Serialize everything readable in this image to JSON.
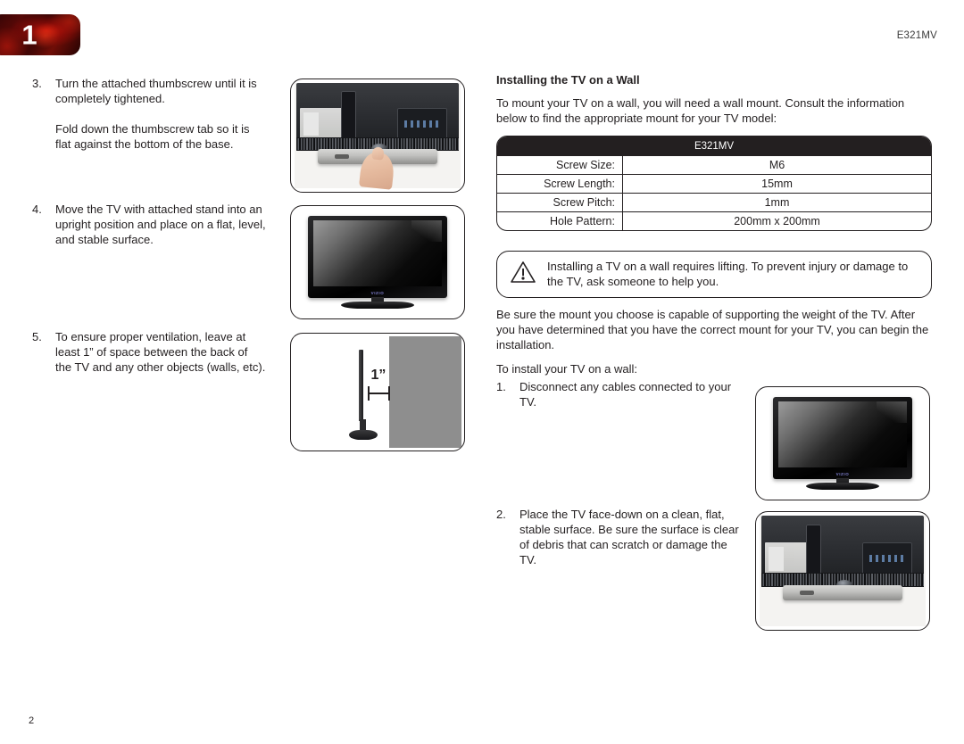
{
  "header": {
    "chapter_number": "1",
    "model": "E321MV"
  },
  "left_column": {
    "steps": [
      {
        "num": "3.",
        "paragraphs": [
          "Turn the attached thumbscrew until it is completely tightened.",
          "Fold down the thumbscrew tab so it is flat against the bottom of the base."
        ]
      },
      {
        "num": "4.",
        "paragraphs": [
          "Move the TV with attached stand into an upright position and place on a flat, level, and stable surface."
        ]
      },
      {
        "num": "5.",
        "paragraphs": [
          "To ensure proper ventilation, leave at least 1” of space between the back of the TV and any other objects (walls, etc)."
        ]
      }
    ]
  },
  "figures": {
    "thumbscrew_caption": "",
    "clearance_label": "1”",
    "tv_logo": "VIZIO"
  },
  "right_column": {
    "heading": "Installing the TV on a Wall",
    "intro": "To mount your TV on a wall, you will need a wall mount. Consult the information below to find the appropriate mount for your TV model:",
    "table": {
      "header": "E321MV",
      "rows": [
        {
          "label": "Screw Size:",
          "value": "M6"
        },
        {
          "label": "Screw Length:",
          "value": "15mm"
        },
        {
          "label": "Screw Pitch:",
          "value": "1mm"
        },
        {
          "label": "Hole Pattern:",
          "value": "200mm x 200mm"
        }
      ]
    },
    "warning": "Installing a TV on a wall requires lifting. To prevent injury or damage to the TV, ask someone to help you.",
    "body_paragraph": "Be sure the mount you choose is capable of supporting the weight of the TV. After you have determined that you have the correct mount for your TV, you can begin the installation.",
    "lead_in": "To install your TV on a wall:",
    "steps": [
      {
        "num": "1.",
        "text": "Disconnect any cables connected to your TV."
      },
      {
        "num": "2.",
        "text": "Place the TV face-down on a clean, flat, stable surface. Be sure the surface is clear of debris that can scratch or damage the TV."
      }
    ]
  },
  "footer": {
    "page_number": "2"
  },
  "colors": {
    "text": "#231f20",
    "table_header_bg": "#231f20",
    "badge_red": "#7d1008",
    "wall_gray": "#8e8e8e"
  }
}
